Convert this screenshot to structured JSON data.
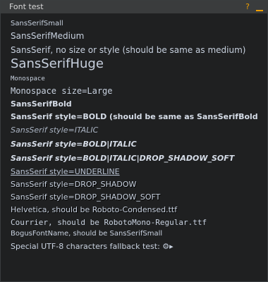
{
  "window": {
    "title": "Font test",
    "controls": {
      "help_icon": "?",
      "minimize_icon": "minimize"
    }
  },
  "content": {
    "lines": [
      "SansSerifSmall",
      "SansSerifMedium",
      "SansSerif, no size or style (should be same as medium)",
      "SansSerifHuge",
      "Monospace",
      "Monospace size=Large",
      "SansSerifBold",
      "SansSerif style=BOLD (should be same as SansSerifBold)",
      "SansSerif style=ITALIC",
      "SansSerif style=BOLD|ITALIC",
      "SansSerif style=BOLD|ITALIC|DROP_SHADOW_SOFT",
      "SansSerif style=UNDERLINE",
      "SansSerif style=DROP_SHADOW",
      "SansSerif style=DROP_SHADOW_SOFT",
      "Helvetica, should be Roboto-Condensed.ttf",
      "Courrier, should be RobotoMono-Regular.ttf",
      "BogusFontName, should be SansSerifSmall",
      "Special UTF-8 characters fallback test: ⚙▸"
    ]
  }
}
